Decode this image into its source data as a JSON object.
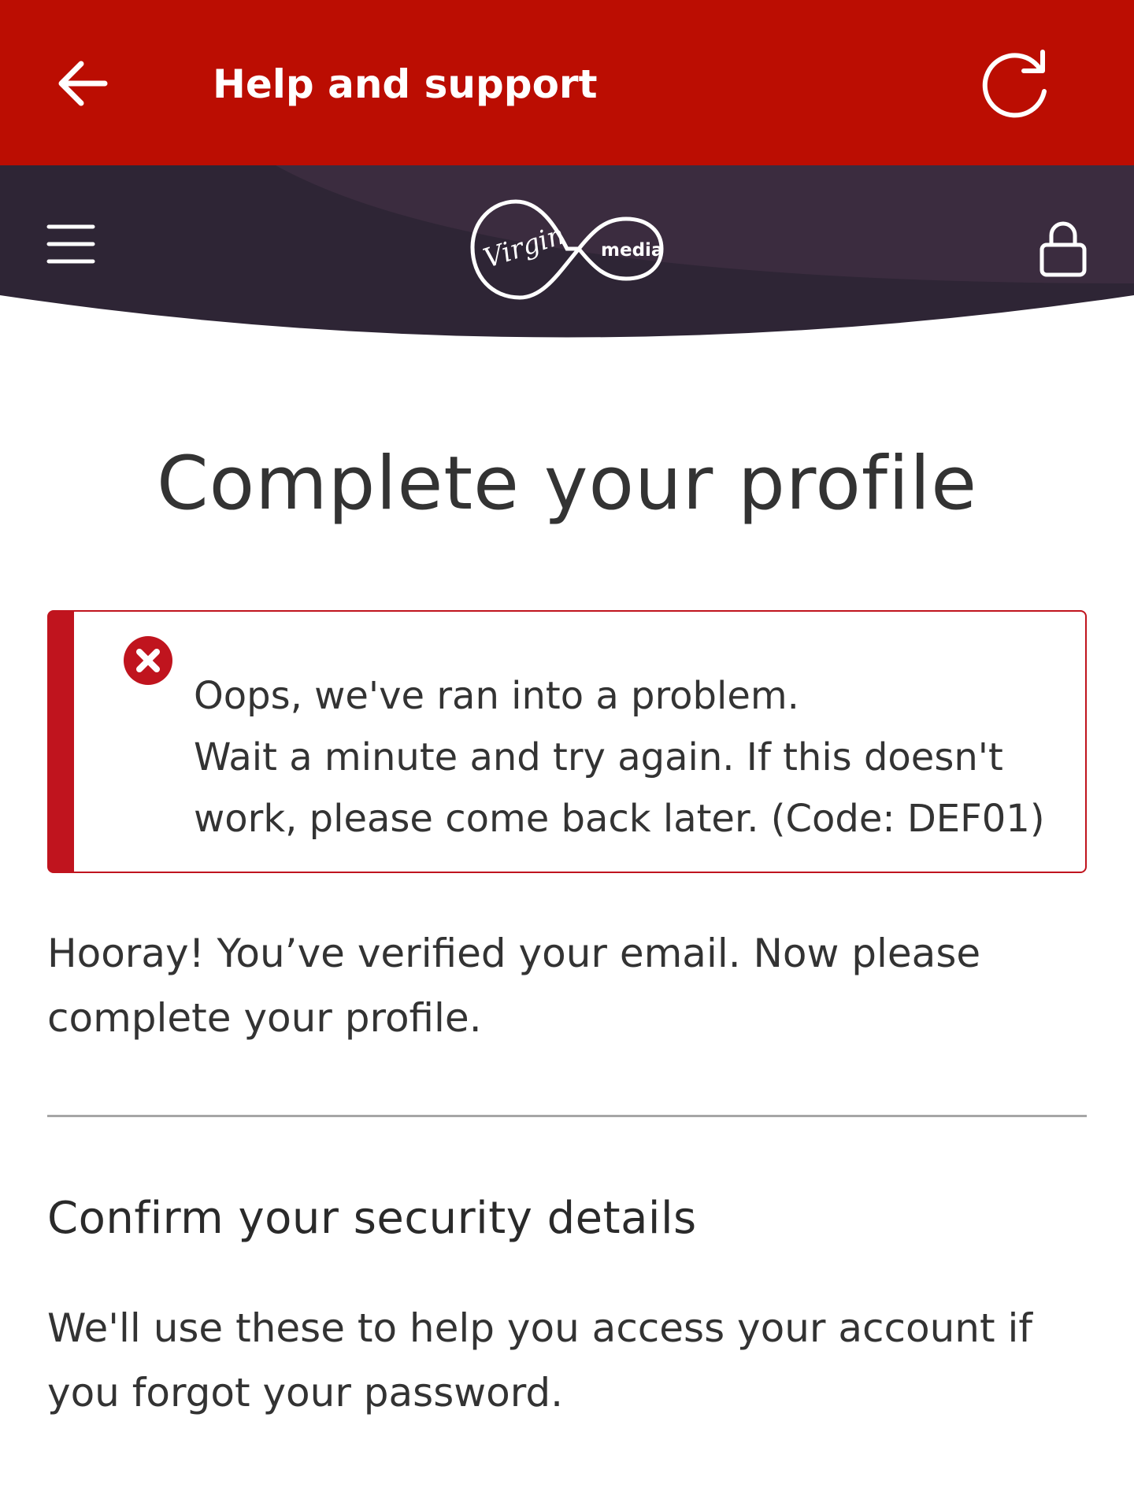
{
  "header": {
    "title": "Help and support",
    "back_icon": "arrow-left-icon",
    "refresh_icon": "refresh-icon",
    "background_color": "#bb0d02"
  },
  "brand_bar": {
    "menu_icon": "hamburger-menu-icon",
    "lock_icon": "lock-icon",
    "logo": {
      "script_text": "Virgin",
      "text": "media"
    },
    "background_color": "#2e2535"
  },
  "main": {
    "title": "Complete your profile",
    "error": {
      "icon": "error-x-icon",
      "line1": "Oops, we've ran into a problem.",
      "line2": "Wait a minute and try again. If this doesn't",
      "line3": "work, please come back later. (Code: DEF01)",
      "accent_color": "#c0141e"
    },
    "intro": "Hooray! You’ve verified your email. Now please complete your profile.",
    "section": {
      "heading": "Confirm your security details",
      "description": "We'll use these to help you access your account if you forgot your password."
    }
  }
}
